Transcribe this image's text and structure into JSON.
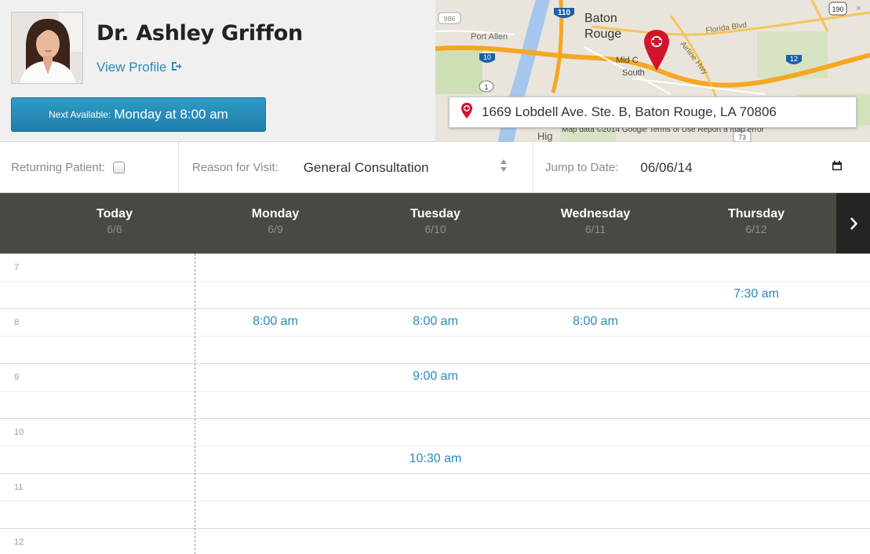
{
  "doctor": {
    "name": "Dr. Ashley Griffon",
    "view_profile_label": "View Profile"
  },
  "next_available": {
    "label": "Next Available:",
    "value": "Monday at 8:00 am"
  },
  "map": {
    "address": "1669 Lobdell Ave. Ste. B, Baton Rouge, LA 70806",
    "places": [
      "Baton",
      "Rouge",
      "Port Allen",
      "Mid C",
      "South",
      "Florida Blvd",
      "Airline Hwy",
      "Hig"
    ],
    "shields": [
      "110",
      "10",
      "12",
      "1",
      "190",
      "73",
      "986"
    ],
    "attribution": "Map data ©2014 Google   Terms of Use   Report a map error"
  },
  "filters": {
    "returning_patient_label": "Returning Patient:",
    "reason_label": "Reason for Visit:",
    "reason_value": "General Consultation",
    "jump_label": "Jump to Date:",
    "jump_value": "06/06/14"
  },
  "days": [
    {
      "name": "Today",
      "date": "6/6"
    },
    {
      "name": "Monday",
      "date": "6/9"
    },
    {
      "name": "Tuesday",
      "date": "6/10"
    },
    {
      "name": "Wednesday",
      "date": "6/11"
    },
    {
      "name": "Thursday",
      "date": "6/12"
    }
  ],
  "hours": [
    "7",
    "8",
    "9",
    "10",
    "11",
    "12"
  ],
  "slots": [
    {
      "day": 4,
      "hour": 0,
      "half": 1,
      "label": "7:30 am"
    },
    {
      "day": 1,
      "hour": 1,
      "half": 0,
      "label": "8:00 am"
    },
    {
      "day": 2,
      "hour": 1,
      "half": 0,
      "label": "8:00 am"
    },
    {
      "day": 3,
      "hour": 1,
      "half": 0,
      "label": "8:00 am"
    },
    {
      "day": 2,
      "hour": 2,
      "half": 0,
      "label": "9:00 am"
    },
    {
      "day": 2,
      "hour": 3,
      "half": 1,
      "label": "10:30 am"
    }
  ],
  "colors": {
    "accent": "#2b8ab8",
    "day_header_bg": "#4a4843",
    "pin": "#d0142c"
  }
}
